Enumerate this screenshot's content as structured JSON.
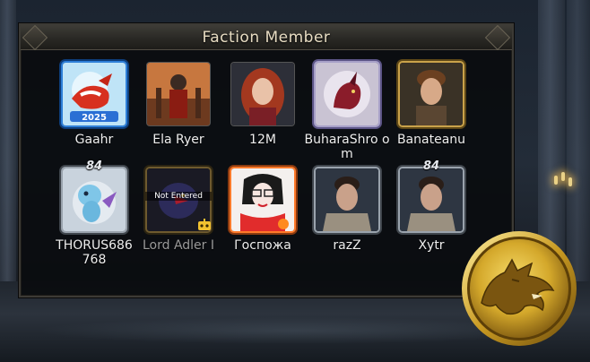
{
  "panel": {
    "title": "Faction Member"
  },
  "members": [
    {
      "name": "Gaahr",
      "frame": "blue",
      "art": "dragon-cartoon"
    },
    {
      "name": "Ela Ryer",
      "frame": "plain",
      "art": "warrior"
    },
    {
      "name": "12M",
      "frame": "plain",
      "art": "red-hair-woman"
    },
    {
      "name": "BuharaShro om",
      "frame": "purple",
      "art": "dragon-portrait"
    },
    {
      "name": "Banateanu",
      "frame": "gold",
      "art": "young-man"
    },
    {
      "name": "THORUS686 768",
      "frame": "silver",
      "art": "baby-dragon",
      "level": "84"
    },
    {
      "name": "Lord Adler I",
      "frame": "dark",
      "art": "eagle",
      "status": "Not Entered",
      "dim": true
    },
    {
      "name": "Госпожа",
      "frame": "orange",
      "art": "glasses-woman"
    },
    {
      "name": "razZ",
      "frame": "silver",
      "art": "knight-man"
    },
    {
      "name": "Xytr",
      "frame": "silver",
      "art": "knight-man",
      "level": "84"
    }
  ],
  "emblem": {
    "icon": "direwolf-sigil-icon",
    "color": "#d4a82b"
  }
}
